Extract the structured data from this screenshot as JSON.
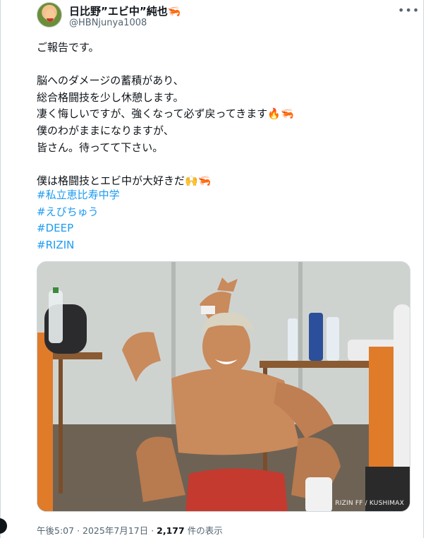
{
  "tweet": {
    "display_name": "日比野”エビ中”純也",
    "name_emoji": "🦐",
    "handle": "@HBNjunya1008",
    "more_icon": "•••",
    "body": "ご報告です。\n\n脳へのダメージの蓄積があり、\n総合格闘技を少し休憩します。\n凄く悔しいですが、強くなって必ず戻ってきます🔥🦐\n僕のわがままになりますが、\n皆さん。待ってて下さい。\n\n僕は格闘技とエビ中が大好きだ🙌🦐",
    "hashtags": [
      "#私立恵比寿中学",
      "#えびちゅう",
      "#DEEP",
      "#RIZIN"
    ],
    "photo_credit": "RIZIN FF / KUSHIMAX",
    "time": "午後5:07",
    "separator": "·",
    "date": "2025年7月17日",
    "views_count": "2,177",
    "views_suffix": "件の表示"
  },
  "colors": {
    "link": "#1d9bf0",
    "secondary_text": "#536471",
    "primary_text": "#0f1419"
  }
}
